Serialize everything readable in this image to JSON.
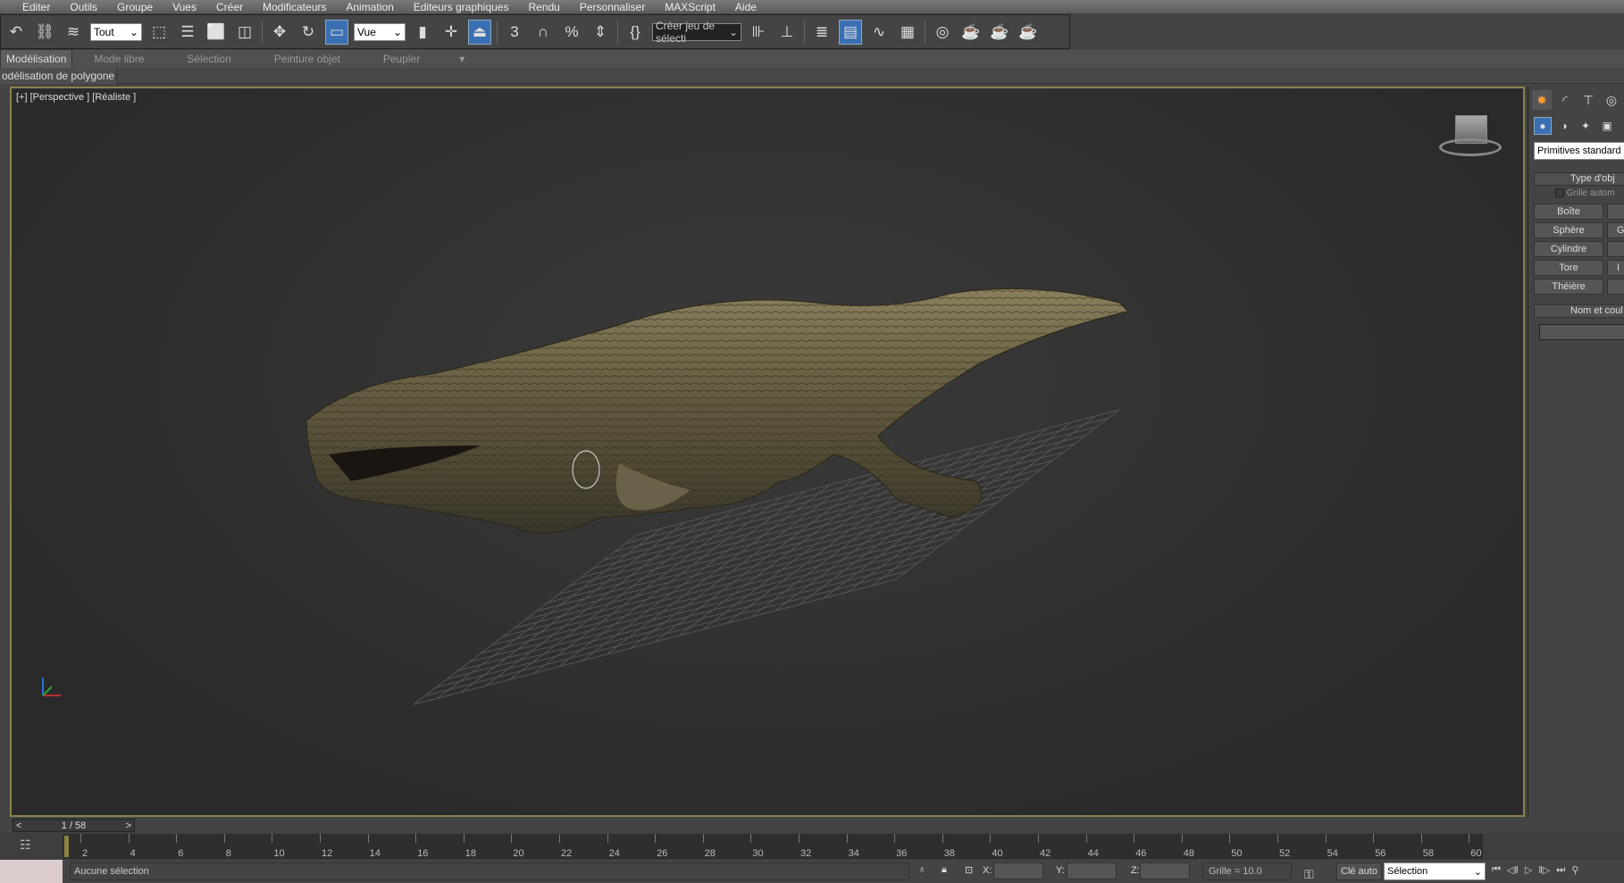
{
  "menu": [
    "Editer",
    "Outils",
    "Groupe",
    "Vues",
    "Créer",
    "Modificateurs",
    "Animation",
    "Editeurs graphiques",
    "Rendu",
    "Personnaliser",
    "MAXScript",
    "Aide"
  ],
  "toolbar": {
    "filter_select": "Tout",
    "coord_select": "Vue",
    "selection_set": "Créer jeu de sélecti",
    "snap_angle": "3",
    "snap_percent": "%"
  },
  "ribbon": {
    "tabs": [
      "Modélisation",
      "Mode libre",
      "Sélection",
      "Peinture objet",
      "Peupler"
    ],
    "active": "Modélisation",
    "subtab": "odélisation de polygone"
  },
  "viewport": {
    "label": "[+] [Perspective ] [Réaliste ]"
  },
  "command_panel": {
    "dropdown": "Primitives standard",
    "rollout1": "Type d'obj",
    "autogrid": "Grille autom",
    "buttons": [
      "Boîte",
      "Sphère",
      "Cylindre",
      "Tore",
      "Théière"
    ],
    "buttons_right": [
      "",
      "G",
      "",
      "I",
      ""
    ],
    "rollout2": "Nom et coul"
  },
  "timeline": {
    "frame": "1 / 58",
    "prev": "<",
    "next": ">",
    "ticks": [
      "2",
      "4",
      "6",
      "8",
      "10",
      "12",
      "14",
      "16",
      "18",
      "20",
      "22",
      "24",
      "26",
      "28",
      "30",
      "32",
      "34",
      "36",
      "38",
      "40",
      "42",
      "44",
      "46",
      "48",
      "50",
      "52",
      "54",
      "56",
      "58",
      "60"
    ]
  },
  "status": {
    "message": "Aucune sélection",
    "x_label": "X:",
    "y_label": "Y:",
    "z_label": "Z:",
    "grid": "Grille = 10.0",
    "auto_key": "Clé auto",
    "key_filter": "Sélection"
  },
  "colors": {
    "viewport_border": "#8a8250",
    "active_blue": "#3b6fb3"
  }
}
